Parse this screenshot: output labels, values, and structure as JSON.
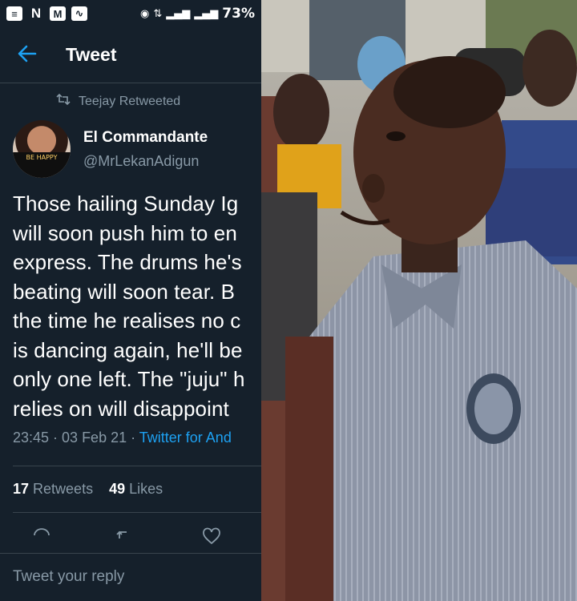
{
  "status_bar": {
    "battery": "73%"
  },
  "header": {
    "back_icon": "arrow-left-icon",
    "title": "Tweet"
  },
  "retweet": {
    "icon": "retweet-icon",
    "text": "Teejay Retweeted"
  },
  "author": {
    "name": "El Commandante",
    "handle": "@MrLekanAdigun",
    "avatar_text": "BE HAPPY"
  },
  "tweet": {
    "lines": [
      "Those hailing Sunday Ig",
      "will soon push him to en",
      "express. The drums he's",
      "beating will soon tear. B",
      "the time he realises no c",
      "is dancing again, he'll be",
      "only one left. The \"juju\" h",
      "relies on will disappoint"
    ],
    "time": "23:45 · 03 Feb 21 · ",
    "client": "Twitter for And"
  },
  "stats": {
    "retweets_count": "17",
    "retweets_label": " Retweets",
    "likes_count": "49",
    "likes_label": " Likes"
  },
  "reply": {
    "placeholder": "Tweet your reply"
  },
  "colors": {
    "background": "#15202b",
    "accent": "#1da1f2",
    "muted": "#8899a6",
    "divider": "#38444d"
  }
}
